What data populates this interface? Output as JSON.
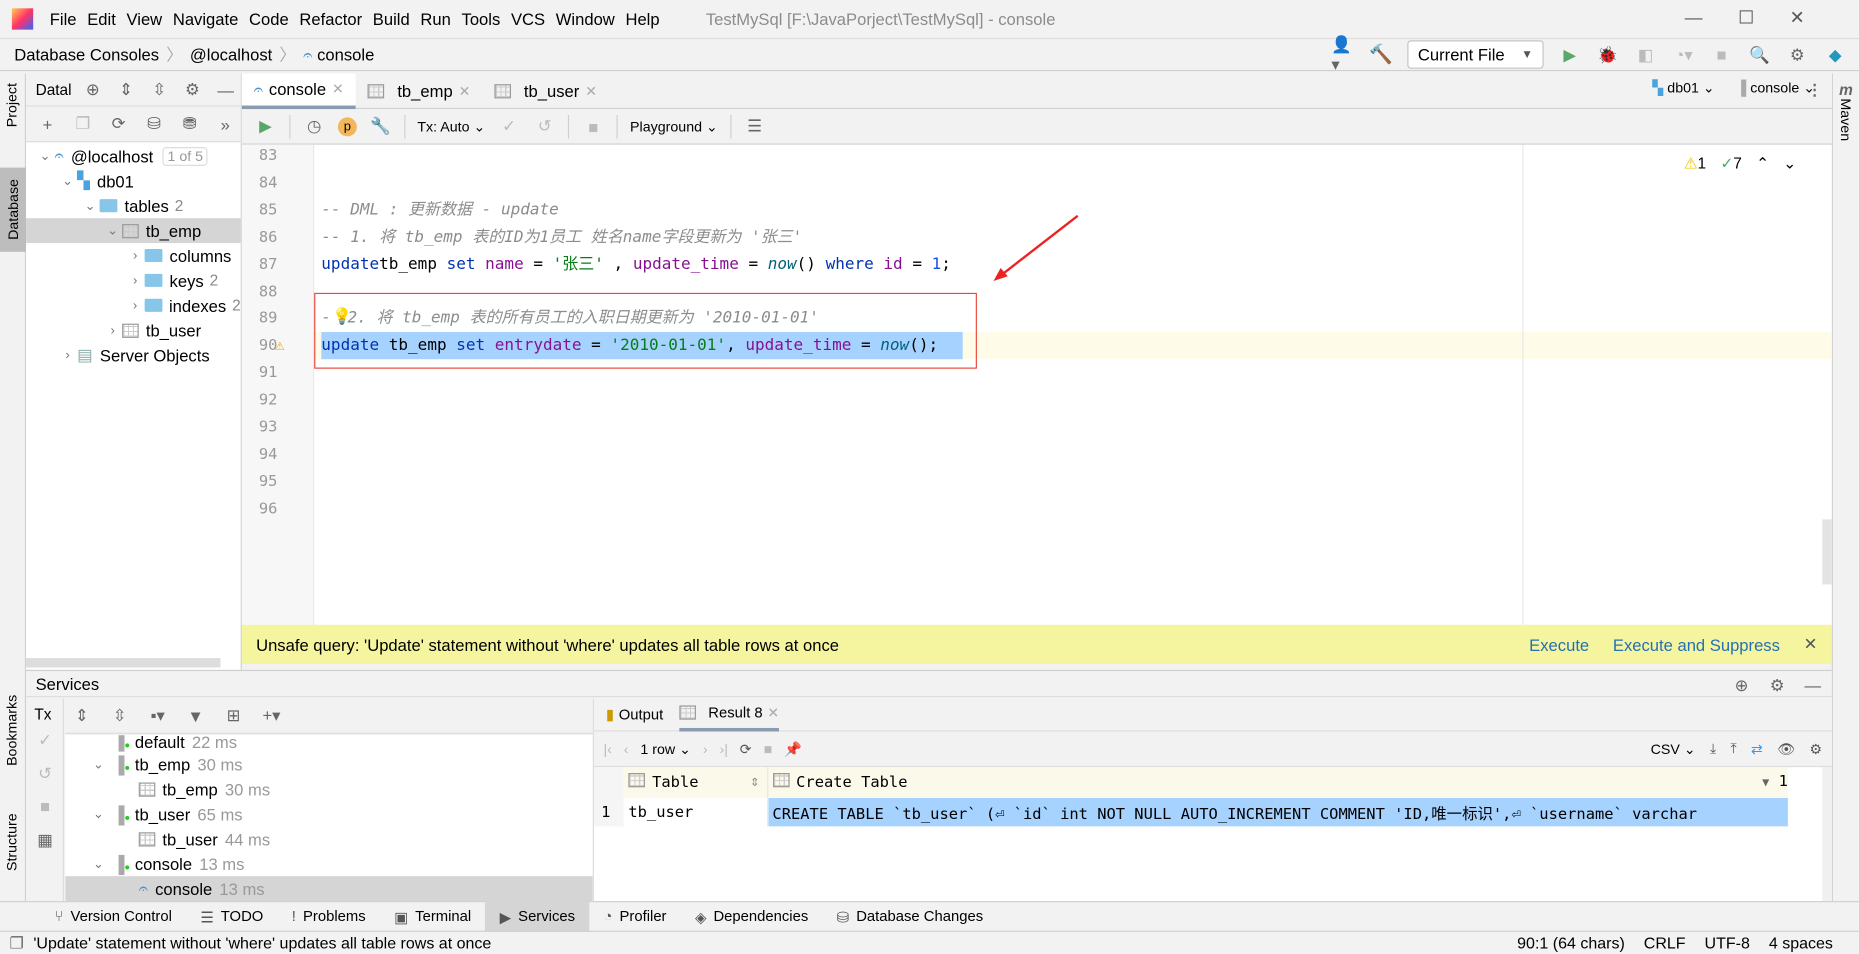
{
  "app": {
    "title": "TestMySql [F:\\JavaPorject\\TestMySql] - console",
    "menu": [
      "File",
      "Edit",
      "View",
      "Navigate",
      "Code",
      "Refactor",
      "Build",
      "Run",
      "Tools",
      "VCS",
      "Window",
      "Help"
    ]
  },
  "breadcrumb": [
    "Database Consoles",
    "@localhost",
    "console"
  ],
  "toolbar": {
    "run_config": "Current File"
  },
  "left_stripe": [
    "Project",
    "Database",
    "Bookmarks",
    "Structure"
  ],
  "right_stripe": [
    "Maven"
  ],
  "db_panel": {
    "title": "Datal",
    "tree": [
      {
        "label": "@localhost",
        "badge": "1 of 5",
        "depth": 0,
        "open": true,
        "icon": "mysql-icon"
      },
      {
        "label": "db01",
        "depth": 1,
        "open": true,
        "icon": "schema-icon"
      },
      {
        "label": "tables",
        "count": "2",
        "depth": 2,
        "open": true,
        "icon": "folder-icon"
      },
      {
        "label": "tb_emp",
        "depth": 3,
        "open": true,
        "icon": "table-icon",
        "selected": true
      },
      {
        "label": "columns",
        "depth": 4,
        "open": false,
        "icon": "folder-icon"
      },
      {
        "label": "keys",
        "count": "2",
        "depth": 4,
        "open": false,
        "icon": "folder-icon"
      },
      {
        "label": "indexes",
        "count": "2",
        "depth": 4,
        "open": false,
        "icon": "folder-icon"
      },
      {
        "label": "tb_user",
        "depth": 3,
        "open": false,
        "icon": "table-icon"
      },
      {
        "label": "Server Objects",
        "depth": 1,
        "open": false,
        "icon": "server-objects-icon"
      }
    ]
  },
  "editor": {
    "tabs": [
      "console",
      "tb_emp",
      "tb_user"
    ],
    "tx": "Tx: Auto",
    "playground": "Playground",
    "schema": "db01",
    "session": "console",
    "warnings": "1",
    "checks": "7",
    "line_numbers": [
      "83",
      "84",
      "85",
      "86",
      "87",
      "88",
      "89",
      "90",
      "91",
      "92",
      "93",
      "94",
      "95",
      "96"
    ],
    "code": {
      "l85": "-- DML : 更新数据 - update",
      "l86": "-- 1. 将 tb_emp 表的ID为1员工 姓名name字段更新为 '张三'",
      "l87": [
        [
          "kw",
          "update"
        ],
        [
          "",
          "tb_emp "
        ],
        [
          "kw",
          "set"
        ],
        [
          "fld",
          " name"
        ],
        [
          "",
          " = "
        ],
        [
          "str",
          "'张三'"
        ],
        [
          "",
          " , "
        ],
        [
          "fld",
          "update_time"
        ],
        [
          "",
          " = "
        ],
        [
          "fn",
          "now"
        ],
        [
          "",
          "() "
        ],
        [
          "kw",
          "where"
        ],
        [
          "fld",
          " id"
        ],
        [
          "",
          " = "
        ],
        [
          "num",
          "1"
        ],
        [
          "",
          ";"
        ]
      ],
      "l89": "-",
      "l89b": "2. 将 tb_emp 表的所有员工的入职日期更新为 '2010-01-01'",
      "l90": [
        [
          "kw",
          "update"
        ],
        [
          "",
          " tb_emp "
        ],
        [
          "kw",
          "set"
        ],
        [
          "fld",
          " entrydate"
        ],
        [
          "",
          " = "
        ],
        [
          "str",
          "'2010-01-01'"
        ],
        [
          "",
          ", "
        ],
        [
          "fld",
          "update_time"
        ],
        [
          "",
          " = "
        ],
        [
          "fn",
          "now"
        ],
        [
          "",
          "();"
        ]
      ]
    }
  },
  "banner": {
    "message": "Unsafe query: 'Update' statement without 'where' updates all table rows at once",
    "execute": "Execute",
    "execute_suppress": "Execute and Suppress"
  },
  "services": {
    "title": "Services",
    "tx": "Tx",
    "tree": [
      {
        "label": "default",
        "time": "22 ms",
        "depth": 1,
        "icon": "session-icon"
      },
      {
        "label": "tb_emp",
        "time": "30 ms",
        "depth": 1,
        "icon": "session-icon",
        "open": true
      },
      {
        "label": "tb_emp",
        "time": "30 ms",
        "depth": 2,
        "icon": "table-icon"
      },
      {
        "label": "tb_user",
        "time": "65 ms",
        "depth": 1,
        "icon": "session-icon",
        "open": true
      },
      {
        "label": "tb_user",
        "time": "44 ms",
        "depth": 2,
        "icon": "table-icon"
      },
      {
        "label": "console",
        "time": "13 ms",
        "depth": 1,
        "icon": "session-icon",
        "open": true
      },
      {
        "label": "console",
        "time": "13 ms",
        "depth": 2,
        "icon": "mysql-icon",
        "selected": true
      }
    ],
    "result_tabs": [
      "Output",
      "Result 8"
    ],
    "rows": "1 row",
    "export": "CSV",
    "columns": [
      "Table",
      "Create Table"
    ],
    "page": "1",
    "result_rows": [
      {
        "n": "1",
        "table": "tb_user",
        "create": "CREATE TABLE `tb_user` (⏎  `id` int NOT NULL AUTO_INCREMENT COMMENT 'ID,唯一标识',⏎  `username` varchar"
      }
    ]
  },
  "toolwindows": [
    "Version Control",
    "TODO",
    "Problems",
    "Terminal",
    "Services",
    "Profiler",
    "Dependencies",
    "Database Changes"
  ],
  "status": {
    "message": "'Update' statement without 'where' updates all table rows at once",
    "position": "90:1 (64 chars)",
    "line_sep": "CRLF",
    "encoding": "UTF-8",
    "indent": "4 spaces"
  },
  "colors": {
    "accent": "#2470b3",
    "banner": "#f5f5a0",
    "selection": "#a6d2ff",
    "annotation": "#e84a3c"
  }
}
